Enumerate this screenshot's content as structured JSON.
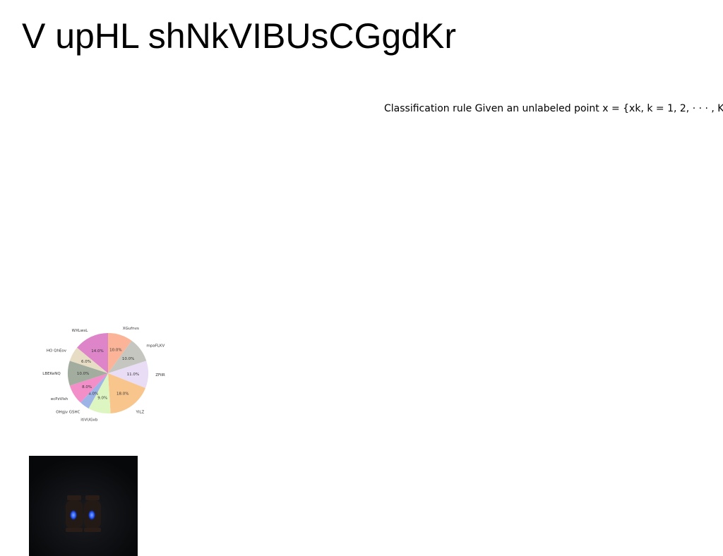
{
  "page": {
    "title": "V upHL shNkVIBUsCGgdKr",
    "body_text": "Classification rule Given an unlabeled point x = {xk, k = 1, 2, · · · , K},"
  },
  "chart_data": {
    "type": "pie",
    "title": "",
    "slices": [
      {
        "label": "XGufnvs",
        "value": 10.0,
        "pct_label": "10.0%",
        "color": "#fbb497"
      },
      {
        "label": "mpaFLKV",
        "value": 10.0,
        "pct_label": "10.0%",
        "color": "#c5c6bf"
      },
      {
        "label": "ZFiIR",
        "value": 11.0,
        "pct_label": "11.0%",
        "color": "#e9dcf5"
      },
      {
        "label": "YlLZ",
        "value": 18.0,
        "pct_label": "18.0%",
        "color": "#f8c58d"
      },
      {
        "label": "itiVUGxb",
        "value": 9.0,
        "pct_label": "9.0%",
        "color": "#ddf6c1"
      },
      {
        "label": "OHgjv GSHC",
        "value": 4.0,
        "pct_label": "4.0%",
        "color": "#9db4e6"
      },
      {
        "label": "ecPzVIsh",
        "value": 8.0,
        "pct_label": "8.0%",
        "color": "#f28ec8"
      },
      {
        "label": "JLBEKeNQ",
        "value": 10.0,
        "pct_label": "10.0%",
        "color": "#a3ad9f"
      },
      {
        "label": "HO QhEov",
        "value": 6.0,
        "pct_label": "6.0%",
        "color": "#e7dcc4"
      },
      {
        "label": "WXLwsL",
        "value": 14.0,
        "pct_label": "14.0%",
        "color": "#dd85c8"
      }
    ],
    "start_angle": "12 o'clock",
    "direction": "clockwise",
    "legend": "none"
  },
  "photo": {
    "background_color": "#0b0d10",
    "object_color": "#2a1d18",
    "glow_color": "#3a6dff"
  }
}
